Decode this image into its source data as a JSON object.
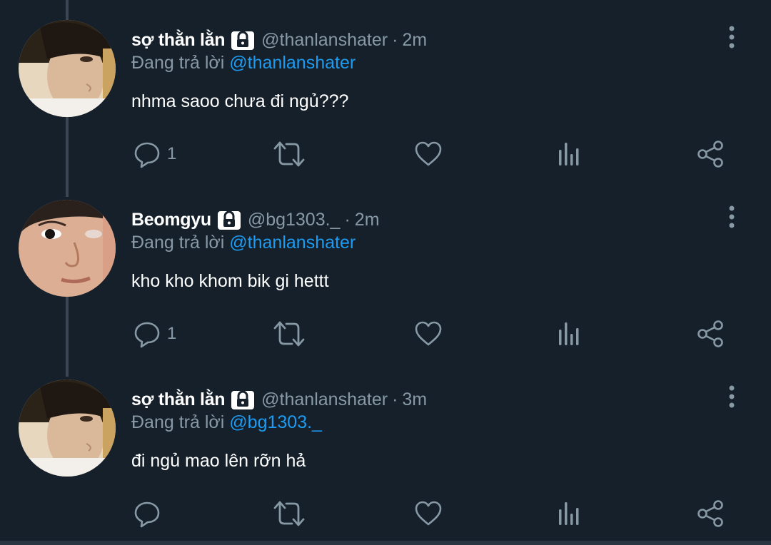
{
  "reply_prefix": "Đang trả lời",
  "tweets": [
    {
      "name": "sợ thằn lằn",
      "handle": "@thanlanshater",
      "separator": "·",
      "time": "2m",
      "reply_to": "@thanlanshater",
      "text": "nhma saoo chưa đi ngủ???",
      "reply_count": "1"
    },
    {
      "name": "Beomgyu",
      "handle": "@bg1303._",
      "separator": "·",
      "time": "2m",
      "reply_to": "@thanlanshater",
      "text": "kho kho khom bik gi hettt",
      "reply_count": "1"
    },
    {
      "name": "sợ thằn lằn",
      "handle": "@thanlanshater",
      "separator": "·",
      "time": "3m",
      "reply_to": "@bg1303._",
      "text": "đi ngủ mao lên rỡn hả",
      "reply_count": ""
    }
  ],
  "icons": [
    "lock-icon",
    "more-options-icon",
    "reply-icon",
    "retweet-icon",
    "like-icon",
    "stats-icon",
    "share-icon"
  ],
  "colors": {
    "background": "#15202b",
    "text": "#ffffff",
    "muted": "#8899a6",
    "mention": "#1d9bf0",
    "thread_line": "#3a4654"
  }
}
